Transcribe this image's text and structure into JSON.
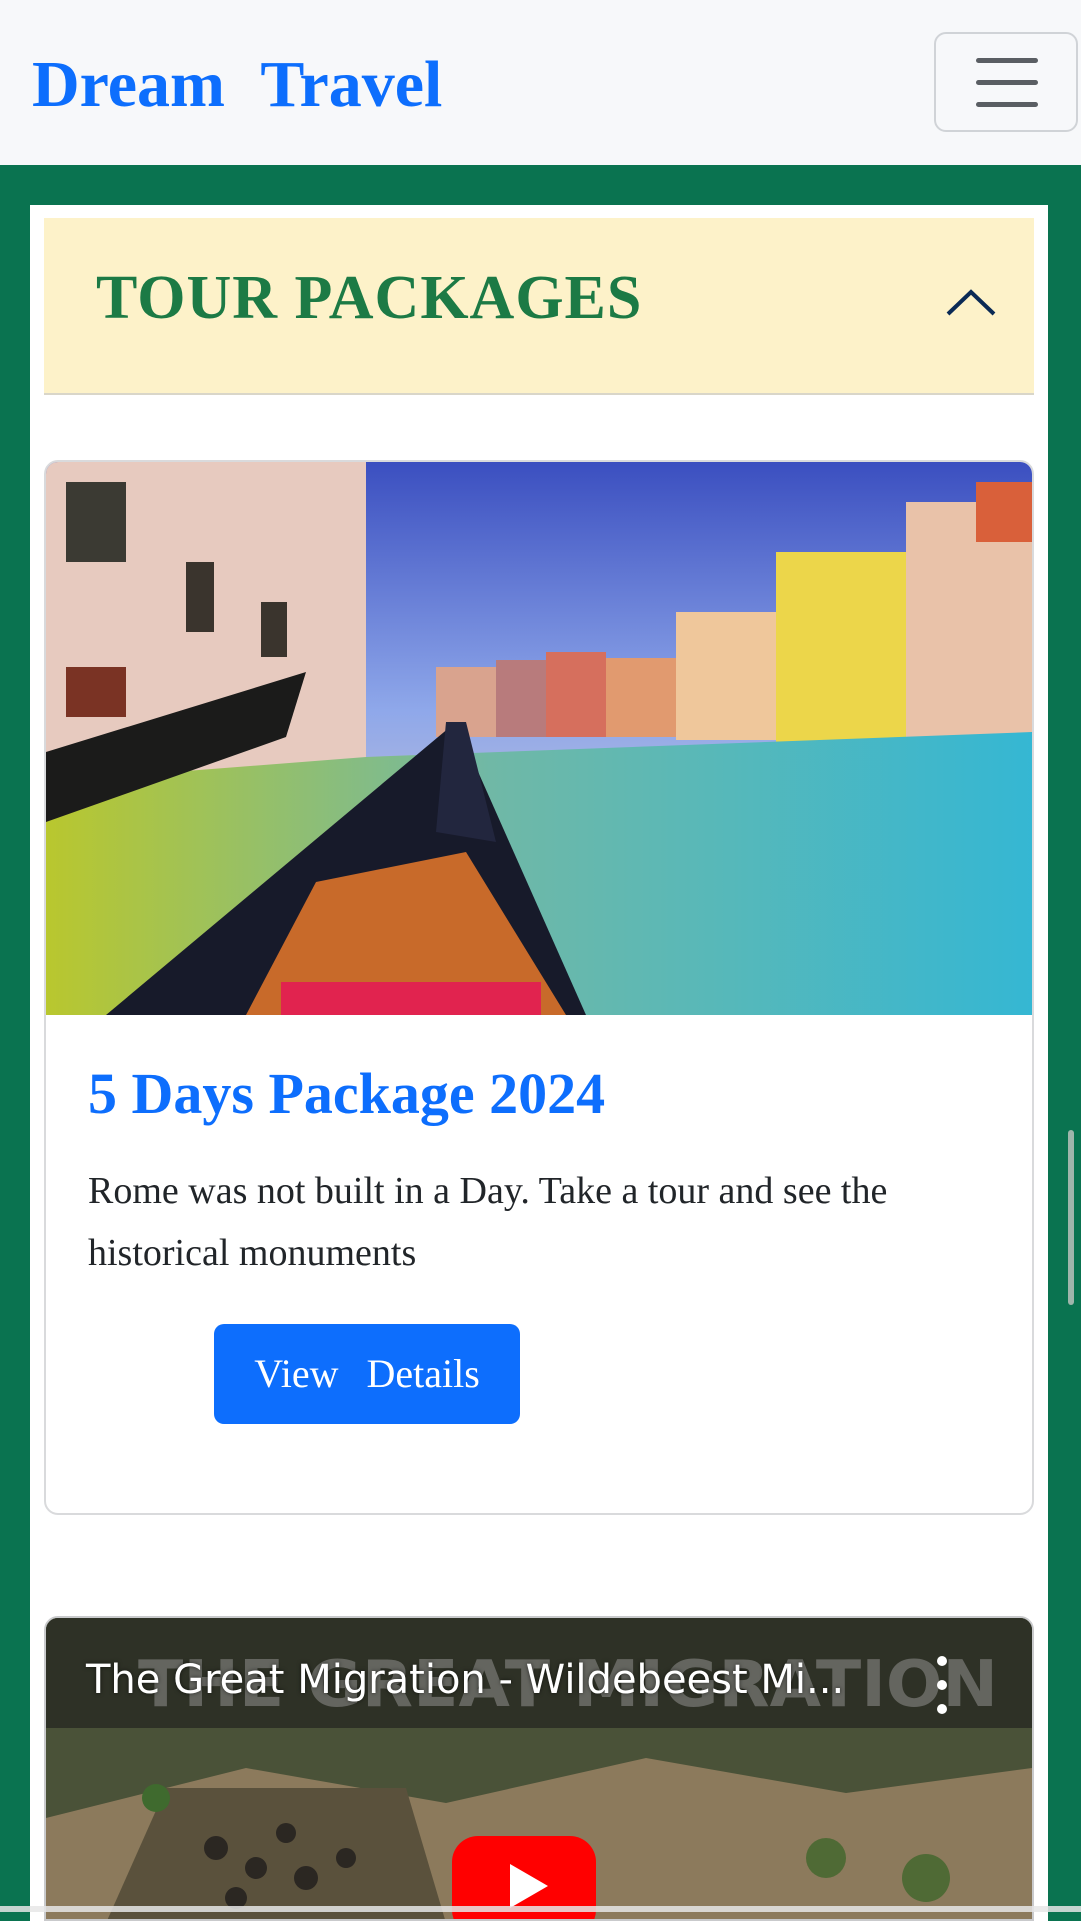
{
  "navbar": {
    "brand": "Dream  Travel",
    "menu_icon": "hamburger-menu-icon"
  },
  "accordion": {
    "title": "TOUR PACKAGES",
    "toggle_icon": "chevron-up-icon",
    "expanded": true
  },
  "package_card": {
    "image_icon": "venice-canal-gondola-photo",
    "title": "5 Days Package 2024",
    "description": "Rome was not built in a Day. Take a tour and see the historical monuments",
    "button_label": "View   Details"
  },
  "video": {
    "title": "The Great Migration - Wildebeest Mi...",
    "overlay_text": "THE GREAT MIGRATION",
    "menu_icon": "more-vertical-icon",
    "play_icon": "youtube-play-icon"
  },
  "colors": {
    "brand": "#0d6efd",
    "page_bg": "#0a7350",
    "accordion_bg": "#fdf2c9",
    "accordion_title": "#1c7a45",
    "button": "#0d6efd"
  }
}
